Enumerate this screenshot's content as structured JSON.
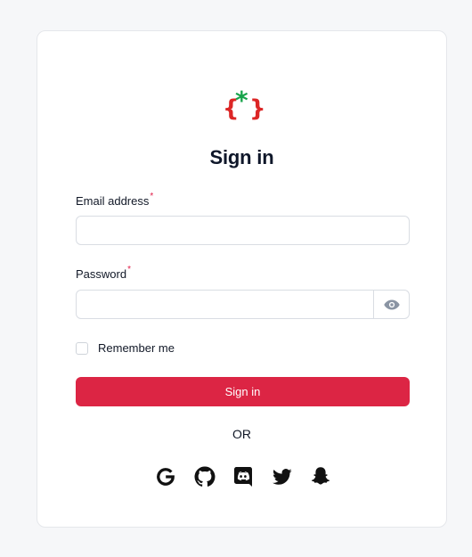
{
  "colors": {
    "accent": "#dc2544",
    "logo_brace": "#dc2626",
    "logo_asterisk": "#16a34a",
    "page_background": "#f6f7f9"
  },
  "logo": {
    "icon": "brace-asterisk-logo",
    "left_brace": "{",
    "asterisk": "*",
    "right_brace": "}"
  },
  "form": {
    "title": "Sign in",
    "email": {
      "label": "Email address",
      "required_marker": "*",
      "value": "",
      "placeholder": ""
    },
    "password": {
      "label": "Password",
      "required_marker": "*",
      "value": "",
      "placeholder": "",
      "toggle_icon": "eye-icon"
    },
    "remember": {
      "label": "Remember me",
      "checked": false
    },
    "submit_label": "Sign in",
    "divider_text": "OR"
  },
  "social_logins": [
    {
      "provider": "google",
      "icon": "google-icon"
    },
    {
      "provider": "github",
      "icon": "github-icon"
    },
    {
      "provider": "discord",
      "icon": "discord-icon"
    },
    {
      "provider": "twitter",
      "icon": "twitter-icon"
    },
    {
      "provider": "snapchat",
      "icon": "snapchat-icon"
    }
  ]
}
